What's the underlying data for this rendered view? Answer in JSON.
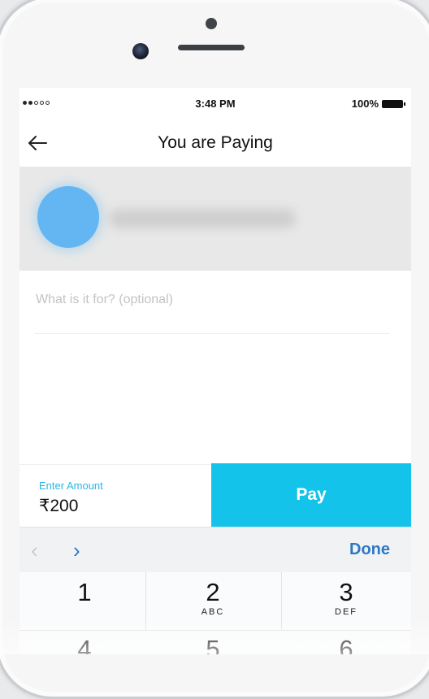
{
  "status_bar": {
    "time": "3:48 PM",
    "battery": "100%"
  },
  "header": {
    "title": "You are Paying",
    "back_icon": "back-arrow-icon"
  },
  "note": {
    "placeholder": "What is it for? (optional)",
    "value": ""
  },
  "amount": {
    "label": "Enter Amount",
    "value": "₹200"
  },
  "pay_button": {
    "label": "Pay"
  },
  "keyboard_toolbar": {
    "prev": "‹",
    "next": "›",
    "done": "Done"
  },
  "keypad": {
    "row1": [
      {
        "num": "1",
        "letters": ""
      },
      {
        "num": "2",
        "letters": "ABC"
      },
      {
        "num": "3",
        "letters": "DEF"
      }
    ],
    "row2": [
      {
        "num": "4",
        "letters": ""
      },
      {
        "num": "5",
        "letters": ""
      },
      {
        "num": "6",
        "letters": ""
      }
    ]
  },
  "colors": {
    "accent": "#14c3ea",
    "link": "#2f78c4",
    "amount_label": "#29b6e6",
    "avatar": "#63b6f2"
  }
}
